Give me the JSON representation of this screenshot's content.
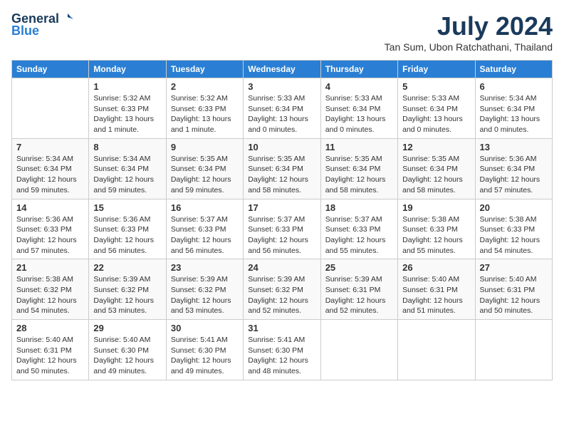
{
  "header": {
    "logo_line1": "General",
    "logo_line2": "Blue",
    "month_year": "July 2024",
    "location": "Tan Sum, Ubon Ratchathani, Thailand"
  },
  "days_of_week": [
    "Sunday",
    "Monday",
    "Tuesday",
    "Wednesday",
    "Thursday",
    "Friday",
    "Saturday"
  ],
  "weeks": [
    [
      {
        "day": "",
        "sunrise": "",
        "sunset": "",
        "daylight": ""
      },
      {
        "day": "1",
        "sunrise": "Sunrise: 5:32 AM",
        "sunset": "Sunset: 6:33 PM",
        "daylight": "Daylight: 13 hours and 1 minute."
      },
      {
        "day": "2",
        "sunrise": "Sunrise: 5:32 AM",
        "sunset": "Sunset: 6:33 PM",
        "daylight": "Daylight: 13 hours and 1 minute."
      },
      {
        "day": "3",
        "sunrise": "Sunrise: 5:33 AM",
        "sunset": "Sunset: 6:34 PM",
        "daylight": "Daylight: 13 hours and 0 minutes."
      },
      {
        "day": "4",
        "sunrise": "Sunrise: 5:33 AM",
        "sunset": "Sunset: 6:34 PM",
        "daylight": "Daylight: 13 hours and 0 minutes."
      },
      {
        "day": "5",
        "sunrise": "Sunrise: 5:33 AM",
        "sunset": "Sunset: 6:34 PM",
        "daylight": "Daylight: 13 hours and 0 minutes."
      },
      {
        "day": "6",
        "sunrise": "Sunrise: 5:34 AM",
        "sunset": "Sunset: 6:34 PM",
        "daylight": "Daylight: 13 hours and 0 minutes."
      }
    ],
    [
      {
        "day": "7",
        "sunrise": "Sunrise: 5:34 AM",
        "sunset": "Sunset: 6:34 PM",
        "daylight": "Daylight: 12 hours and 59 minutes."
      },
      {
        "day": "8",
        "sunrise": "Sunrise: 5:34 AM",
        "sunset": "Sunset: 6:34 PM",
        "daylight": "Daylight: 12 hours and 59 minutes."
      },
      {
        "day": "9",
        "sunrise": "Sunrise: 5:35 AM",
        "sunset": "Sunset: 6:34 PM",
        "daylight": "Daylight: 12 hours and 59 minutes."
      },
      {
        "day": "10",
        "sunrise": "Sunrise: 5:35 AM",
        "sunset": "Sunset: 6:34 PM",
        "daylight": "Daylight: 12 hours and 58 minutes."
      },
      {
        "day": "11",
        "sunrise": "Sunrise: 5:35 AM",
        "sunset": "Sunset: 6:34 PM",
        "daylight": "Daylight: 12 hours and 58 minutes."
      },
      {
        "day": "12",
        "sunrise": "Sunrise: 5:35 AM",
        "sunset": "Sunset: 6:34 PM",
        "daylight": "Daylight: 12 hours and 58 minutes."
      },
      {
        "day": "13",
        "sunrise": "Sunrise: 5:36 AM",
        "sunset": "Sunset: 6:34 PM",
        "daylight": "Daylight: 12 hours and 57 minutes."
      }
    ],
    [
      {
        "day": "14",
        "sunrise": "Sunrise: 5:36 AM",
        "sunset": "Sunset: 6:33 PM",
        "daylight": "Daylight: 12 hours and 57 minutes."
      },
      {
        "day": "15",
        "sunrise": "Sunrise: 5:36 AM",
        "sunset": "Sunset: 6:33 PM",
        "daylight": "Daylight: 12 hours and 56 minutes."
      },
      {
        "day": "16",
        "sunrise": "Sunrise: 5:37 AM",
        "sunset": "Sunset: 6:33 PM",
        "daylight": "Daylight: 12 hours and 56 minutes."
      },
      {
        "day": "17",
        "sunrise": "Sunrise: 5:37 AM",
        "sunset": "Sunset: 6:33 PM",
        "daylight": "Daylight: 12 hours and 56 minutes."
      },
      {
        "day": "18",
        "sunrise": "Sunrise: 5:37 AM",
        "sunset": "Sunset: 6:33 PM",
        "daylight": "Daylight: 12 hours and 55 minutes."
      },
      {
        "day": "19",
        "sunrise": "Sunrise: 5:38 AM",
        "sunset": "Sunset: 6:33 PM",
        "daylight": "Daylight: 12 hours and 55 minutes."
      },
      {
        "day": "20",
        "sunrise": "Sunrise: 5:38 AM",
        "sunset": "Sunset: 6:33 PM",
        "daylight": "Daylight: 12 hours and 54 minutes."
      }
    ],
    [
      {
        "day": "21",
        "sunrise": "Sunrise: 5:38 AM",
        "sunset": "Sunset: 6:32 PM",
        "daylight": "Daylight: 12 hours and 54 minutes."
      },
      {
        "day": "22",
        "sunrise": "Sunrise: 5:39 AM",
        "sunset": "Sunset: 6:32 PM",
        "daylight": "Daylight: 12 hours and 53 minutes."
      },
      {
        "day": "23",
        "sunrise": "Sunrise: 5:39 AM",
        "sunset": "Sunset: 6:32 PM",
        "daylight": "Daylight: 12 hours and 53 minutes."
      },
      {
        "day": "24",
        "sunrise": "Sunrise: 5:39 AM",
        "sunset": "Sunset: 6:32 PM",
        "daylight": "Daylight: 12 hours and 52 minutes."
      },
      {
        "day": "25",
        "sunrise": "Sunrise: 5:39 AM",
        "sunset": "Sunset: 6:31 PM",
        "daylight": "Daylight: 12 hours and 52 minutes."
      },
      {
        "day": "26",
        "sunrise": "Sunrise: 5:40 AM",
        "sunset": "Sunset: 6:31 PM",
        "daylight": "Daylight: 12 hours and 51 minutes."
      },
      {
        "day": "27",
        "sunrise": "Sunrise: 5:40 AM",
        "sunset": "Sunset: 6:31 PM",
        "daylight": "Daylight: 12 hours and 50 minutes."
      }
    ],
    [
      {
        "day": "28",
        "sunrise": "Sunrise: 5:40 AM",
        "sunset": "Sunset: 6:31 PM",
        "daylight": "Daylight: 12 hours and 50 minutes."
      },
      {
        "day": "29",
        "sunrise": "Sunrise: 5:40 AM",
        "sunset": "Sunset: 6:30 PM",
        "daylight": "Daylight: 12 hours and 49 minutes."
      },
      {
        "day": "30",
        "sunrise": "Sunrise: 5:41 AM",
        "sunset": "Sunset: 6:30 PM",
        "daylight": "Daylight: 12 hours and 49 minutes."
      },
      {
        "day": "31",
        "sunrise": "Sunrise: 5:41 AM",
        "sunset": "Sunset: 6:30 PM",
        "daylight": "Daylight: 12 hours and 48 minutes."
      },
      {
        "day": "",
        "sunrise": "",
        "sunset": "",
        "daylight": ""
      },
      {
        "day": "",
        "sunrise": "",
        "sunset": "",
        "daylight": ""
      },
      {
        "day": "",
        "sunrise": "",
        "sunset": "",
        "daylight": ""
      }
    ]
  ]
}
